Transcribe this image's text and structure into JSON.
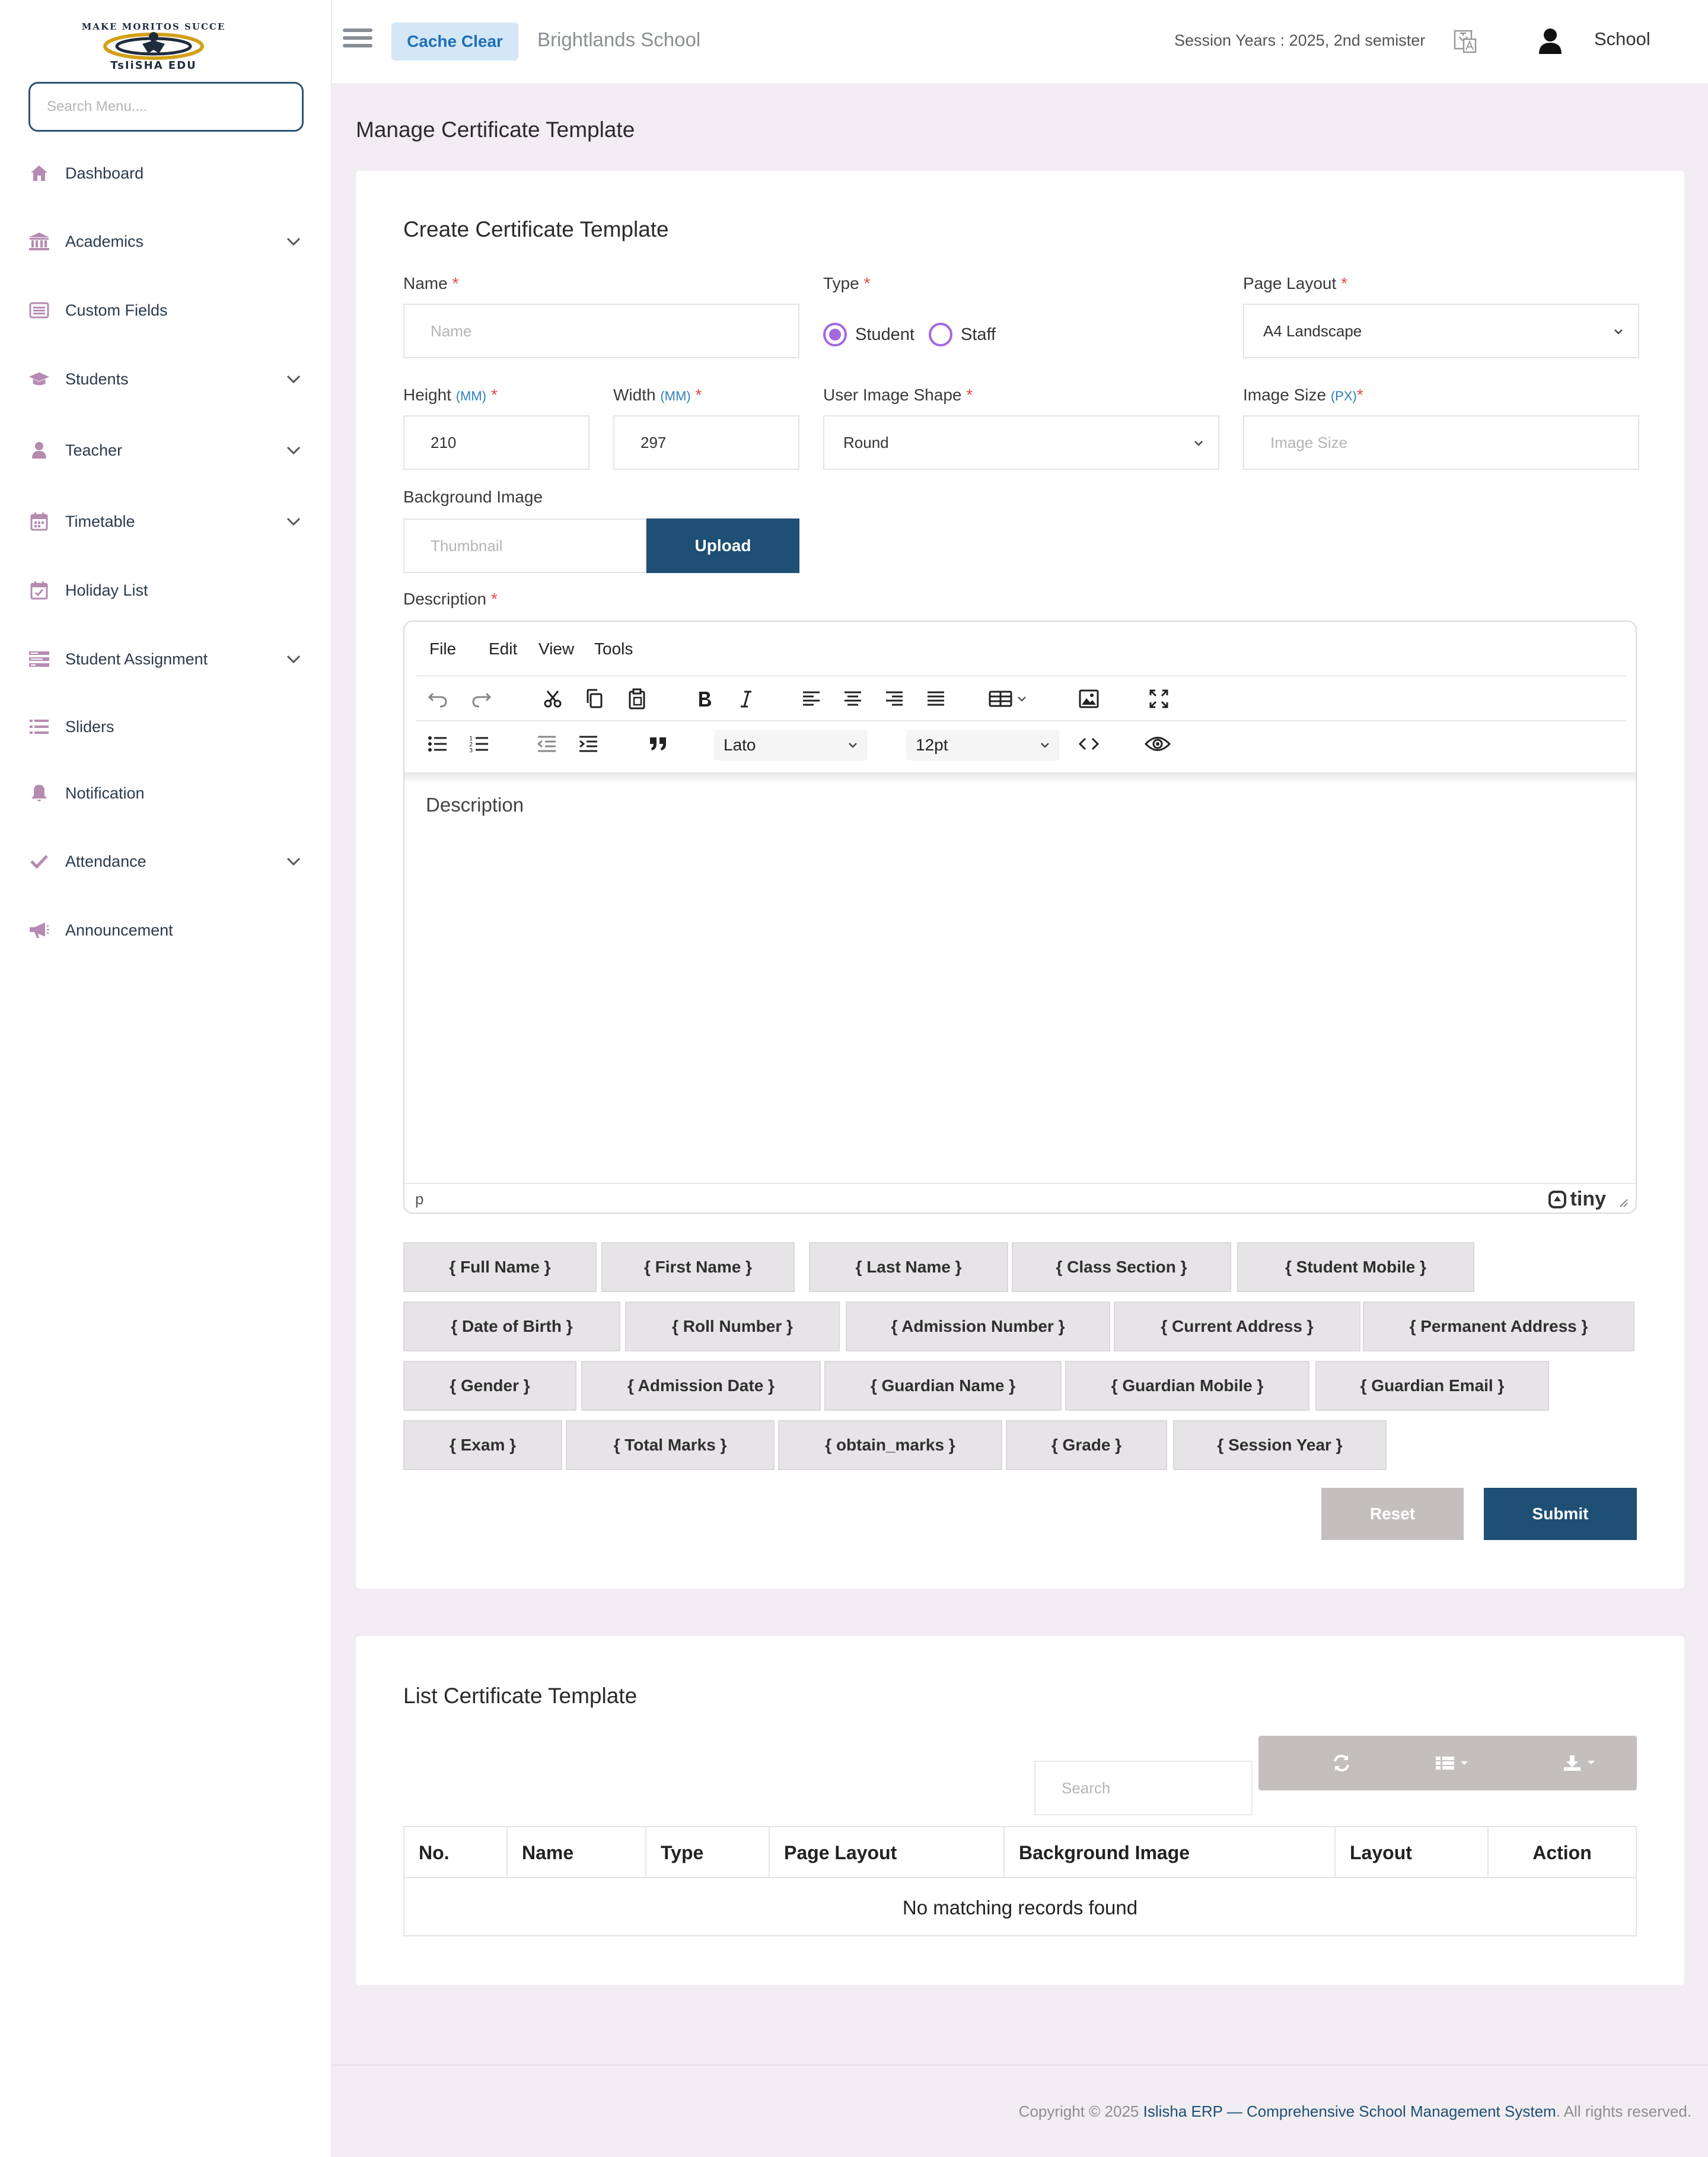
{
  "brand": {
    "logo_text": "TsIiSHA EDU",
    "logo_arc_text": "MAKE MORITOS SUCCE"
  },
  "sidebar": {
    "search_placeholder": "Search Menu....",
    "items": [
      {
        "label": "Dashboard",
        "icon": "home-icon",
        "has_submenu": false
      },
      {
        "label": "Academics",
        "icon": "university-icon",
        "has_submenu": true
      },
      {
        "label": "Custom Fields",
        "icon": "list-alt-icon",
        "has_submenu": false
      },
      {
        "label": "Students",
        "icon": "graduation-cap-icon",
        "has_submenu": true
      },
      {
        "label": "Teacher",
        "icon": "user-icon",
        "has_submenu": true
      },
      {
        "label": "Timetable",
        "icon": "calendar-icon",
        "has_submenu": true
      },
      {
        "label": "Holiday List",
        "icon": "calendar-check-icon",
        "has_submenu": false
      },
      {
        "label": "Student Assignment",
        "icon": "tasks-icon",
        "has_submenu": true
      },
      {
        "label": "Sliders",
        "icon": "list-icon",
        "has_submenu": false
      },
      {
        "label": "Notification",
        "icon": "bell-icon",
        "has_submenu": false
      },
      {
        "label": "Attendance",
        "icon": "check-icon",
        "has_submenu": true
      },
      {
        "label": "Announcement",
        "icon": "bullhorn-icon",
        "has_submenu": false
      }
    ]
  },
  "topbar": {
    "cache_clear": "Cache Clear",
    "school_name": "Brightlands School",
    "session": "Session Years : 2025, 2nd semister",
    "user_name": "School"
  },
  "page": {
    "title": "Manage Certificate Template"
  },
  "form": {
    "title": "Create Certificate Template",
    "name": {
      "label": "Name",
      "placeholder": "Name",
      "value": ""
    },
    "type": {
      "label": "Type",
      "options": [
        "Student",
        "Staff"
      ],
      "selected": "Student"
    },
    "page_layout": {
      "label": "Page Layout",
      "value": "A4 Landscape"
    },
    "height": {
      "label": "Height",
      "unit": "(MM)",
      "value": "210"
    },
    "width": {
      "label": "Width",
      "unit": "(MM)",
      "value": "297"
    },
    "user_image_shape": {
      "label": "User Image Shape",
      "value": "Round"
    },
    "image_size": {
      "label": "Image Size",
      "unit": "(PX)",
      "placeholder": "Image Size"
    },
    "background_image": {
      "label": "Background Image",
      "placeholder": "Thumbnail",
      "button": "Upload"
    },
    "description": {
      "label": "Description",
      "placeholder": "Description"
    },
    "reset": "Reset",
    "submit": "Submit"
  },
  "editor": {
    "menus": [
      "File",
      "Edit",
      "View",
      "Tools"
    ],
    "font_family": "Lato",
    "font_size": "12pt",
    "status_path": "p",
    "brand": "tiny"
  },
  "placeholders": [
    [
      "{ Full Name }",
      "{ First Name }",
      "{ Last Name }",
      "{ Class Section }",
      "{ Student Mobile }"
    ],
    [
      "{ Date of Birth }",
      "{ Roll Number }",
      "{ Admission Number }",
      "{ Current Address }",
      "{ Permanent Address }"
    ],
    [
      "{ Gender }",
      "{ Admission Date }",
      "{ Guardian Name }",
      "{ Guardian Mobile }",
      "{ Guardian Email }"
    ],
    [
      "{ Exam }",
      "{ Total Marks }",
      "{ obtain_marks }",
      "{ Grade }",
      "{ Session Year }"
    ]
  ],
  "list": {
    "title": "List Certificate Template",
    "search_placeholder": "Search",
    "columns": [
      "No.",
      "Name",
      "Type",
      "Page Layout",
      "Background Image",
      "Layout",
      "Action"
    ],
    "empty_message": "No matching records found"
  },
  "footer": {
    "prefix": "Copyright © 2025 ",
    "link": "Islisha ERP — Comprehensive School Management System",
    "suffix": ". All rights reserved."
  },
  "colors": {
    "primary": "#1e4f75",
    "accent": "#a567e0",
    "required": "#e14b4b",
    "unit": "#2f7fc1",
    "sidebar_icon": "#b58bb2"
  }
}
